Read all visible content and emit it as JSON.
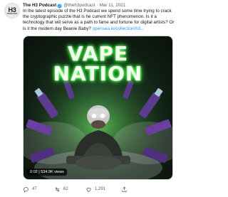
{
  "author": {
    "name": "The H3 Podcast",
    "handle": "@theh3podcast",
    "date": "Mar 11, 2021",
    "avatar_text": "H3",
    "avatar_subtext": "PODCAST"
  },
  "tweet": {
    "text": "In the latest episode of the H3 Podcast we spend some time trying to crack the cryptographic puzzle that is he current NFT phenomenon. Is it a technology that will serve as a path to fame and fortune for digital artists? Or is it the modern day Beanie Baby?",
    "link_text": "opensea.io/collection/h3..."
  },
  "media": {
    "title_line1": "VAPE",
    "title_line2": "NATION",
    "duration": "0:02",
    "views": "534.9K views"
  },
  "actions": {
    "replies": "47",
    "retweets": "62",
    "likes": "1,291"
  },
  "colors": {
    "accent": "#1d9bf0",
    "glow": "#2cff3a"
  }
}
